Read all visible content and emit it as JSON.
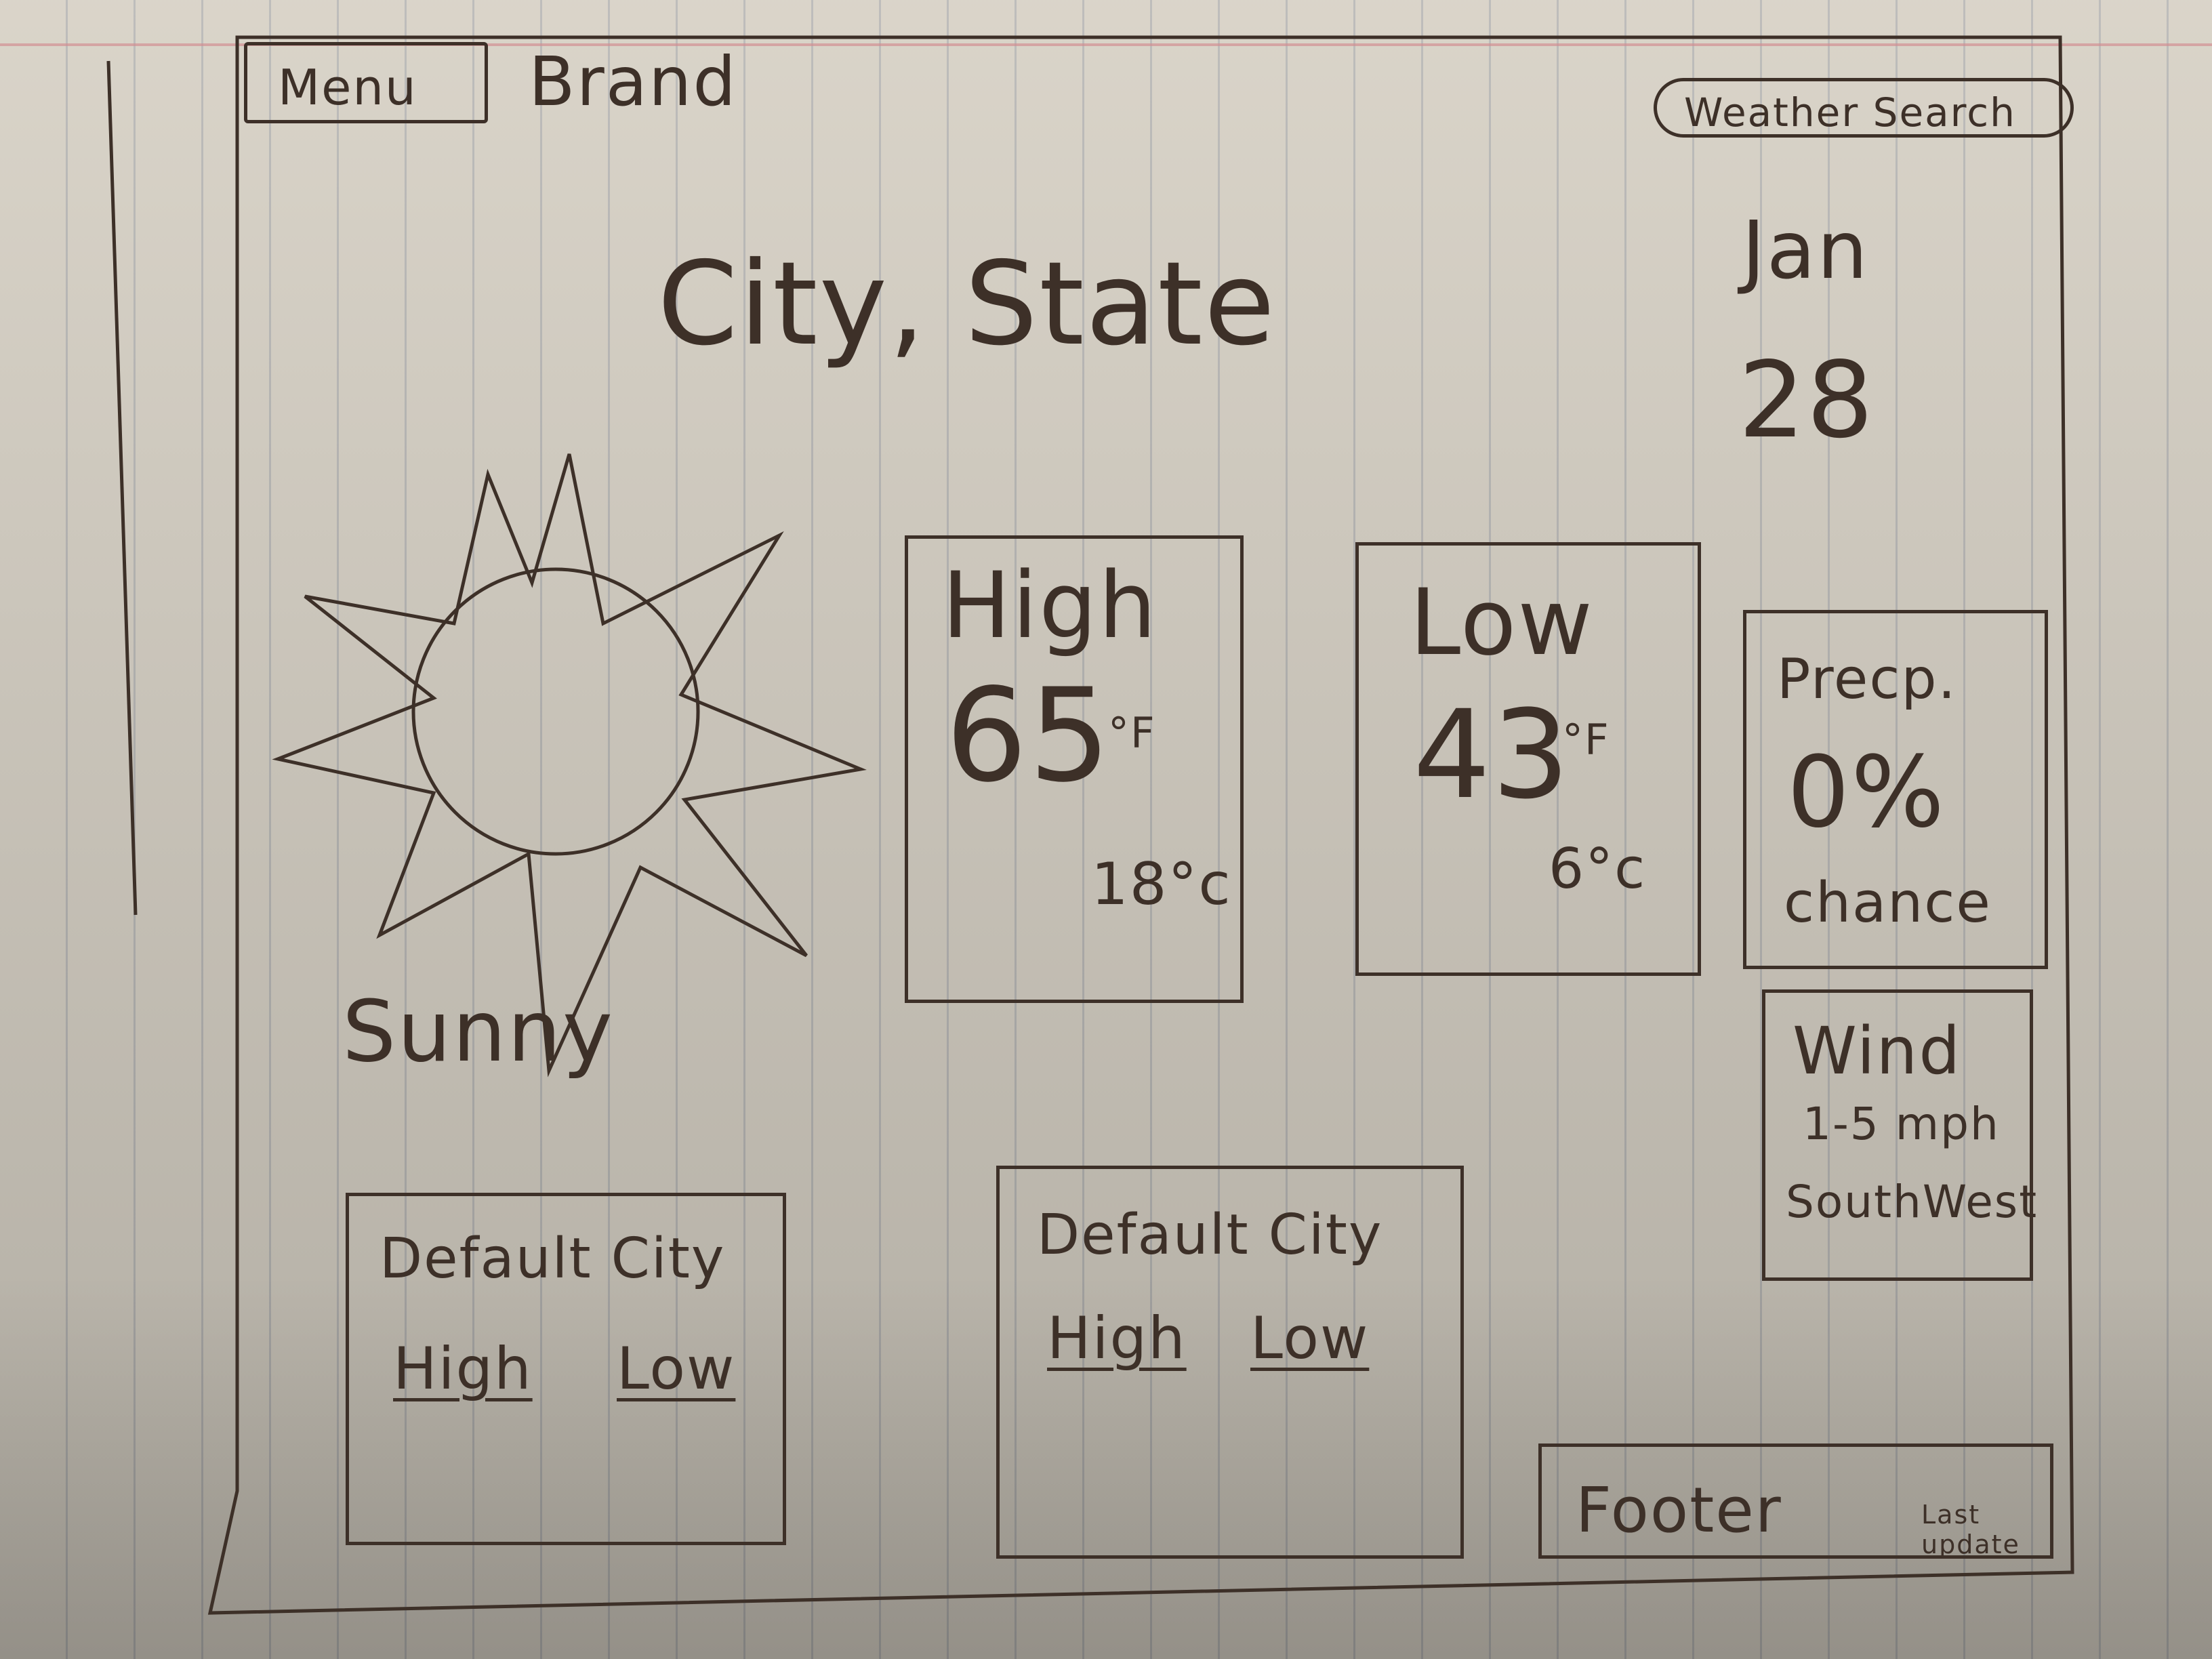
{
  "nav": {
    "menu_label": "Menu",
    "brand": "Brand",
    "search_label": "Weather Search"
  },
  "location": {
    "title": "City, State"
  },
  "date": {
    "month": "Jan",
    "day": "28"
  },
  "current": {
    "condition": "Sunny",
    "icon": "sun-icon"
  },
  "high": {
    "label": "High",
    "value_f": "65",
    "unit_f": "°F",
    "value_c": "18°c"
  },
  "low": {
    "label": "Low",
    "value_f": "43",
    "unit_f": "°F",
    "value_c": "6°c"
  },
  "precip": {
    "label": "Precp.",
    "value": "0%",
    "suffix": "chance"
  },
  "wind": {
    "label": "Wind",
    "speed": "1-5 mph",
    "direction": "SouthWest"
  },
  "default_cities": [
    {
      "name": "Default City",
      "high_label": "High",
      "low_label": "Low"
    },
    {
      "name": "Default City",
      "high_label": "High",
      "low_label": "Low"
    }
  ],
  "footer": {
    "label": "Footer",
    "last_update": "Last update"
  }
}
